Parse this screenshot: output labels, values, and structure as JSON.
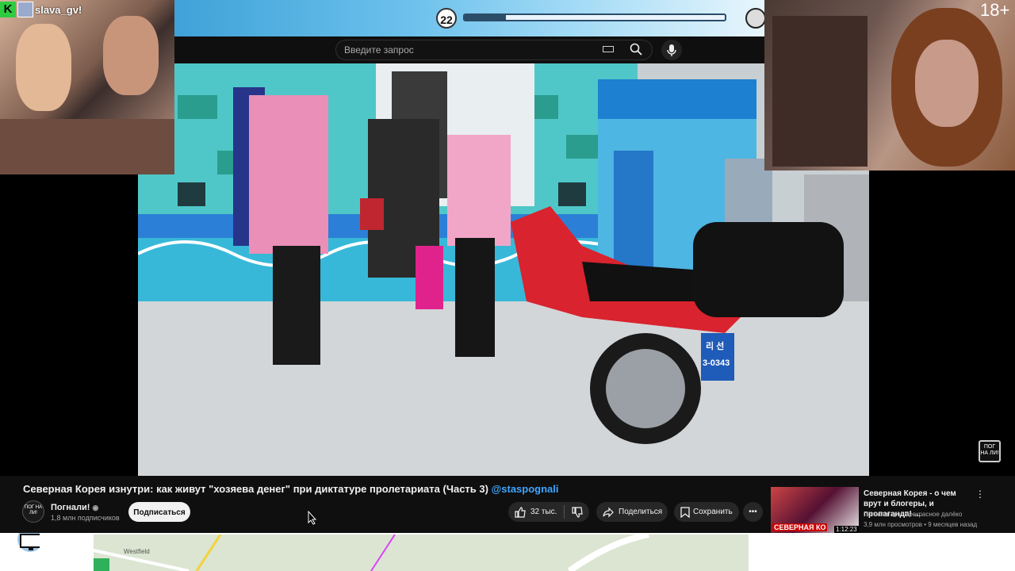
{
  "overlay": {
    "timer_value": "22",
    "progress_fraction": 0.16
  },
  "webcam_left": {
    "badge": "K",
    "username": "slava_gv​!"
  },
  "webcam_right": {
    "age_label": "18+"
  },
  "search": {
    "placeholder": "Введите запрос"
  },
  "video": {
    "plate_top": "리 선",
    "plate_bottom": "3-0343",
    "watermark": "ПОГ НА ЛИ!"
  },
  "info": {
    "title": "Северная Корея изнутри: как живут \"хозяева денег\" при диктатуре пролетариата (Часть 3)",
    "handle": "@stаspognali",
    "channel_name": "Погнали!",
    "subscribers": "1,8 млн подписчиков",
    "subscribe_label": "Подписаться",
    "like_count": "32 тыс.",
    "share_label": "Поделиться",
    "save_label": "Сохранить",
    "more_label": "•••",
    "avatar_text": "ПОГ НА ЛИ!"
  },
  "recommended": {
    "title": "Северная Корея - о чем врут и блогеры, и пропаганда! ...",
    "channel": "Погнали! ◉ и Прекрасное далёко",
    "meta": "3,9 млн просмотров • 9 месяцев назад",
    "thumb_text": "СЕВЕРНАЯ КО",
    "duration": "1:12:23",
    "menu": "⋮"
  },
  "map": {
    "label": "Westfield"
  },
  "colors": {
    "accent_blue": "#3ea6ff",
    "panel_bg": "#0f0f0f",
    "pill_bg": "#272727"
  }
}
